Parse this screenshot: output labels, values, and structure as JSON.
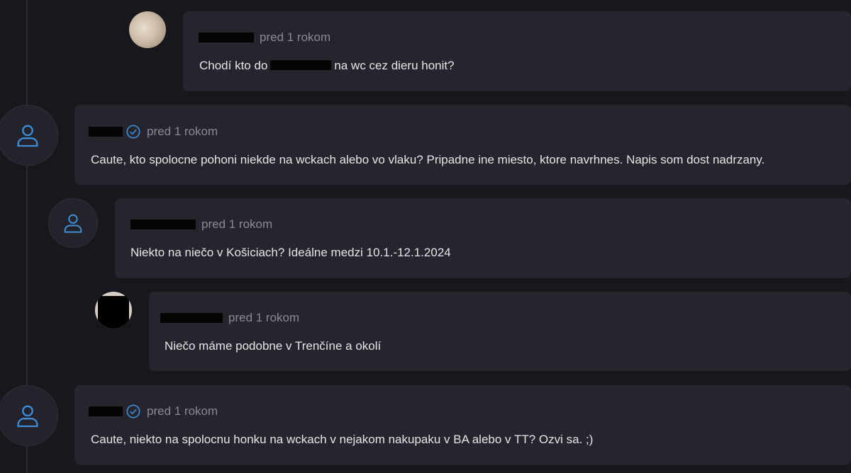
{
  "comments": [
    {
      "username": "[redacted]",
      "time": "pred 1 rokom",
      "text_before": "Chodí kto do",
      "text_after": "na wc cez dieru honit?",
      "avatar": "photo",
      "verified": false
    },
    {
      "username": "[redacted]",
      "time": "pred 1 rokom",
      "text": "Caute, kto spolocne pohoni niekde na wckach alebo vo vlaku? Pripadne ine miesto, ktore navrhnes. Napis som dost nadrzany.",
      "avatar": "default-user-icon",
      "verified": true
    },
    {
      "username": "[redacted]",
      "time": "pred 1 rokom",
      "text": "Niekto na niečo v Košiciach? Ideálne medzi 10.1.-12.1.2024",
      "avatar": "default-user-icon",
      "verified": false
    },
    {
      "username": "[redacted]",
      "time": "pred 1 rokom",
      "text": "Niečo máme podobne v Trenčíne a okolí",
      "avatar": "photo",
      "verified": false
    },
    {
      "username": "[redacted]",
      "time": "pred 1 rokom",
      "text": "Caute, niekto na spolocnu honku na wckach v nejakom nakupaku v BA alebo v TT? Ozvi sa. ;)",
      "avatar": "default-user-icon",
      "verified": true
    }
  ],
  "colors": {
    "background": "#18171d",
    "card": "#26252d",
    "accent": "#3d8ed6",
    "muted_text": "#8b8a93",
    "text": "#e6e5ea"
  },
  "icons": [
    "user-icon",
    "verified-check-icon"
  ]
}
